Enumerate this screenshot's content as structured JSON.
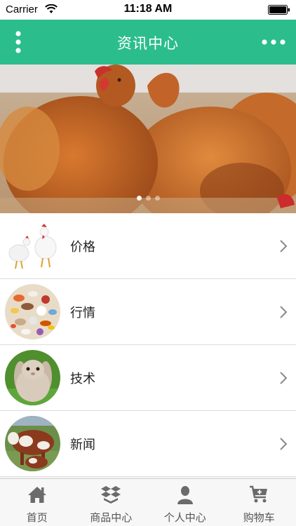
{
  "status_bar": {
    "carrier": "Carrier",
    "time": "11:18 AM",
    "icons": [
      "wifi-icon",
      "battery-icon"
    ]
  },
  "nav_bar": {
    "title": "资讯中心",
    "left_icon": "menu-dots-vertical-icon",
    "right_icon": "more-dots-icon",
    "background": "#2cbd8d"
  },
  "banner": {
    "image": "chickens-photo",
    "slide_count": 3,
    "active_slide": 1
  },
  "list": {
    "items": [
      {
        "label": "价格",
        "thumb": "white-chickens-image"
      },
      {
        "label": "行情",
        "thumb": "pills-image"
      },
      {
        "label": "技术",
        "thumb": "rabbit-image"
      },
      {
        "label": "新闻",
        "thumb": "cattle-image"
      }
    ]
  },
  "tab_bar": {
    "tabs": [
      {
        "label": "首页",
        "icon": "home-icon"
      },
      {
        "label": "商品中心",
        "icon": "boxes-icon"
      },
      {
        "label": "个人中心",
        "icon": "person-icon"
      },
      {
        "label": "购物车",
        "icon": "cart-icon"
      }
    ]
  },
  "colors": {
    "accent": "#2cbd8d",
    "text": "#222222",
    "tab_text": "#555555"
  }
}
